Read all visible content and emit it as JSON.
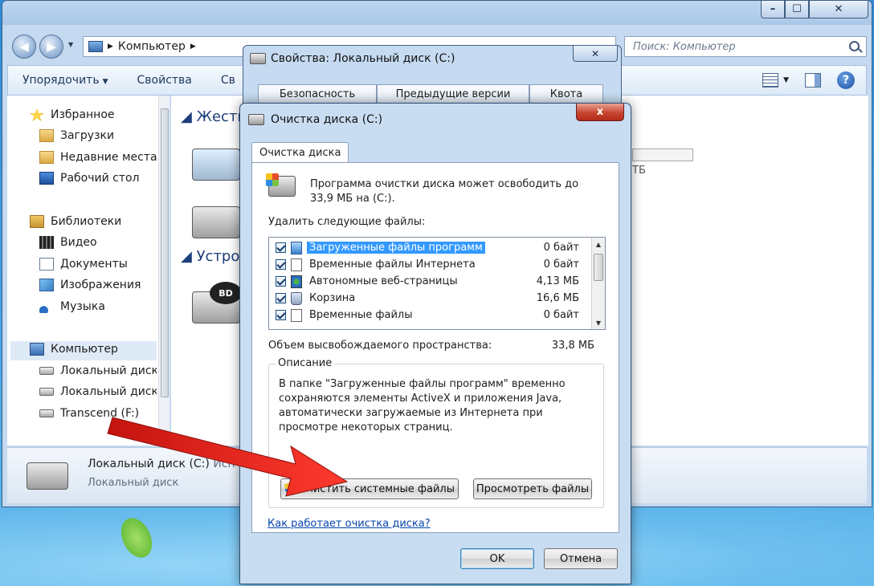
{
  "explorer": {
    "address": "Компьютер",
    "search_placeholder": "Поиск: Компьютер",
    "toolbar": {
      "organize": "Упорядочить",
      "properties": "Свойства",
      "system_cut": "Св"
    },
    "nav": {
      "favorites": "Избранное",
      "downloads": "Загрузки",
      "recent": "Недавние места",
      "desktop": "Рабочий стол",
      "libraries": "Библиотеки",
      "video": "Видео",
      "documents": "Документы",
      "images": "Изображения",
      "music": "Музыка",
      "computer": "Компьютер",
      "local_disk_1": "Локальный диск",
      "local_disk_2": "Локальный диск",
      "transcend": "Transcend (F:)"
    },
    "sections": {
      "hard_disks": "Жестк",
      "devices": "Устрой"
    },
    "bd_label": "BD",
    "tb_hint": "ТБ",
    "details": {
      "name": "Локальный диск (C:)",
      "name_suffix": "Исп",
      "type": "Локальный диск"
    }
  },
  "properties": {
    "title": "Свойства: Локальный диск (C:)",
    "tabs": [
      "Безопасность",
      "Предыдущие версии",
      "Квота"
    ]
  },
  "cleanup": {
    "title": "Очистка диска  (C:)",
    "close": "x",
    "tab": "Очистка диска",
    "intro": "Программа очистки диска может освободить до 33,9 МБ на  (C:).",
    "list_label": "Удалить следующие файлы:",
    "files": [
      {
        "name": "Загруженные файлы программ",
        "size": "0 байт"
      },
      {
        "name": "Временные файлы Интернета",
        "size": "0 байт"
      },
      {
        "name": "Автономные веб-страницы",
        "size": "4,13 МБ"
      },
      {
        "name": "Корзина",
        "size": "16,6 МБ"
      },
      {
        "name": "Временные файлы",
        "size": "0 байт"
      }
    ],
    "space_label": "Объем высвобождаемого пространства:",
    "space_value": "33,8 МБ",
    "desc_legend": "Описание",
    "desc_text": "В папке \"Загруженные файлы программ\" временно сохраняются элементы ActiveX и приложения Java, автоматически загружаемые из Интернета при просмотре некоторых страниц.",
    "clean_system": "Очистить системные файлы",
    "view_files": "Просмотреть файлы",
    "help_link": "Как работает очистка диска?",
    "ok": "OK",
    "cancel": "Отмена"
  },
  "colors": {
    "arrow": "#e0201b",
    "selection": "#3399ff",
    "link": "#0645ad"
  }
}
